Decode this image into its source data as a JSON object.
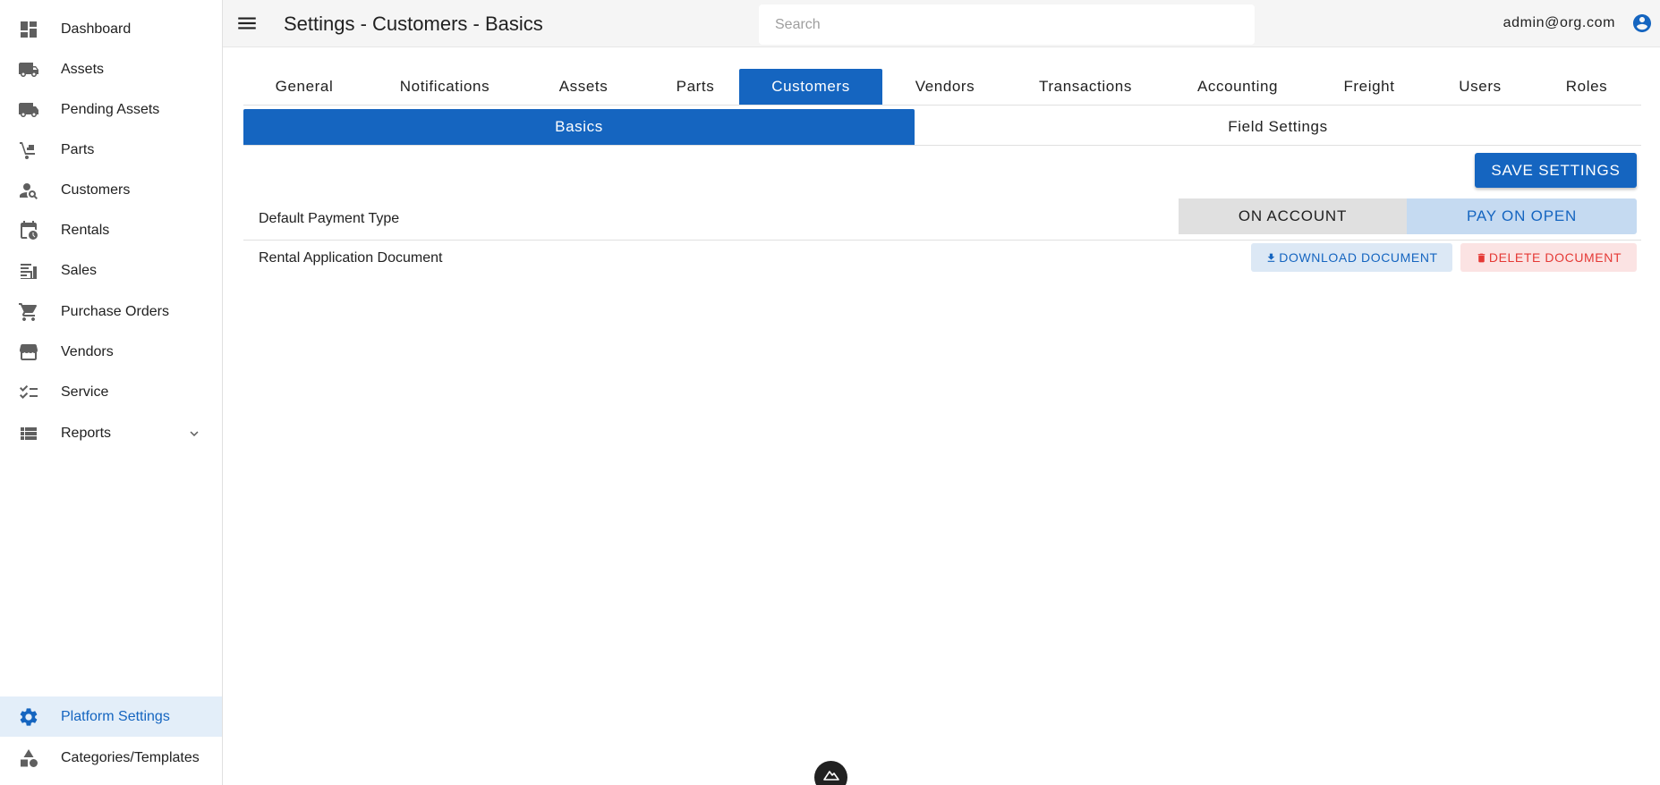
{
  "sidebar": {
    "items": [
      {
        "label": "Dashboard",
        "icon": "dashboard-icon"
      },
      {
        "label": "Assets",
        "icon": "truck-icon"
      },
      {
        "label": "Pending Assets",
        "icon": "truck-clock-icon"
      },
      {
        "label": "Parts",
        "icon": "hand-truck-icon"
      },
      {
        "label": "Customers",
        "icon": "person-search-icon"
      },
      {
        "label": "Rentals",
        "icon": "calendar-clock-icon"
      },
      {
        "label": "Sales",
        "icon": "ledger-icon"
      },
      {
        "label": "Purchase Orders",
        "icon": "cart-icon"
      },
      {
        "label": "Vendors",
        "icon": "storefront-icon"
      },
      {
        "label": "Service",
        "icon": "checklist-icon"
      },
      {
        "label": "Reports",
        "icon": "list-icon"
      }
    ],
    "bottom_items": [
      {
        "label": "Platform Settings",
        "icon": "gear-icon"
      },
      {
        "label": "Categories/Templates",
        "icon": "shapes-icon"
      }
    ]
  },
  "header": {
    "title": "Settings - Customers - Basics",
    "search_placeholder": "Search",
    "user_email": "admin@org.com"
  },
  "tabs": [
    "General",
    "Notifications",
    "Assets",
    "Parts",
    "Customers",
    "Vendors",
    "Transactions",
    "Accounting",
    "Freight",
    "Users",
    "Roles"
  ],
  "active_tab": "Customers",
  "subtabs": [
    "Basics",
    "Field Settings"
  ],
  "active_subtab": "Basics",
  "save_label": "SAVE SETTINGS",
  "settings": {
    "payment": {
      "label": "Default Payment Type",
      "option_a": "ON ACCOUNT",
      "option_b": "PAY ON OPEN",
      "selected": "PAY ON OPEN"
    },
    "document": {
      "label": "Rental Application Document",
      "download_label": "DOWNLOAD DOCUMENT",
      "delete_label": "DELETE DOCUMENT"
    }
  },
  "colors": {
    "primary": "#1565c0",
    "danger": "#e53935",
    "active_bg": "#e3eef9"
  }
}
